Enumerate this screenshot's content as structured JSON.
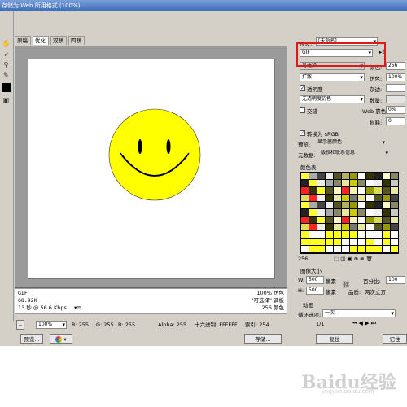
{
  "window": {
    "title": "存储为 Web 所用格式 (100%)"
  },
  "view_tabs": [
    "原稿",
    "优化",
    "双联",
    "四联"
  ],
  "info": {
    "format": "GIF",
    "size": "68.92K",
    "time": "13 秒 @ 56.6 Kbps",
    "quality_pct": "100% 仿色",
    "palette": "\"可选择\" 调板",
    "colors": "256 颜色"
  },
  "statusbar": {
    "zoom": "100%",
    "r": "R: 255",
    "g": "G: 255",
    "b": "B: 255",
    "alpha": "Alpha: 255",
    "hex": "十六进制: FFFFFF",
    "index": "索引: 254"
  },
  "buttons": {
    "preview": "预览...",
    "save": "存储...",
    "reset": "复位",
    "remember": "记住"
  },
  "panel": {
    "preset_label": "预设:",
    "preset_value": "[未命名]",
    "format_value": "GIF",
    "reduction": "可选择",
    "colors_label": "颜色:",
    "colors_value": "256",
    "dither_method": "扩散",
    "dither_label": "仿色:",
    "dither_value": "100%",
    "transparency_label": "透明度",
    "matte_label": "杂边:",
    "trans_dither": "无透明度仿色",
    "amount_label": "数量:",
    "interlaced_label": "交错",
    "web_snap_label": "Web 靠色:",
    "web_snap_value": "0%",
    "lossy_label": "损耗:",
    "lossy_value": "0",
    "srgb_label": "转换为 sRGB",
    "preview_label": "预览:",
    "preview_value": "显示器颜色",
    "metadata_label": "元数据:",
    "metadata_value": "版权和联系信息",
    "color_table_label": "颜色表",
    "color_table_count": "256",
    "image_size_label": "图像大小",
    "w_label": "W:",
    "w_value": "500",
    "h_label": "H:",
    "h_value": "500",
    "px_unit": "像素",
    "percent_label": "百分比:",
    "percent_value": "100",
    "quality_label": "品质:",
    "quality_value": "两次立方",
    "animation_label": "动画",
    "loop_label": "循环选项:",
    "loop_value": "一次",
    "frame_counter": "1/1"
  },
  "watermark": {
    "brand": "Baidu经验",
    "url": "jingyan.baidu.com"
  },
  "colors": {
    "face": "#ffff00",
    "accent_red": "#e01818",
    "palette_bg": "#000000"
  },
  "palette_colors": [
    "#ffff33",
    "#e8e8a0",
    "#222222",
    "#c8c8c8",
    "#777777",
    "#ffffff",
    "#cccc00",
    "#444444",
    "#dddd55",
    "#888866",
    "#ff2222",
    "#f4f4b0",
    "#555522",
    "#aaaaaa",
    "#333300",
    "#eeeeee",
    "#999900",
    "#b0b060",
    "#ffffcc",
    "#666633"
  ]
}
